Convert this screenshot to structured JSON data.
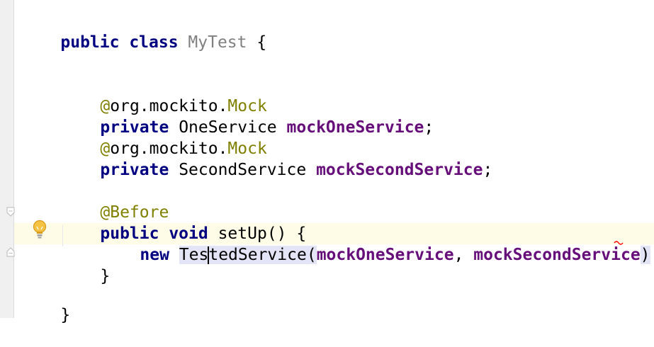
{
  "code": {
    "line1": {
      "kw": "public class",
      "name": "MyTest",
      "brace": "{"
    },
    "line2": {
      "at": "@",
      "pkg": "org.mockito.",
      "ann": "Mock"
    },
    "line3": {
      "kw": "private",
      "type": "OneService",
      "field": "mockOneService",
      "semi": ";"
    },
    "line4": {
      "at": "@",
      "pkg": "org.mockito.",
      "ann": "Mock"
    },
    "line5": {
      "kw": "private",
      "type": "SecondService",
      "field": "mockSecondService",
      "semi": ";"
    },
    "line6": {
      "ann": "@Before"
    },
    "line7": {
      "kw": "public void",
      "method": "setUp() {"
    },
    "line8": {
      "kw": "new",
      "type_before_caret": "Tes",
      "type_after_caret": "tedService",
      "open": "(",
      "arg1": "mockOneService",
      "comma": ", ",
      "arg2": "mockSecondService",
      "close": ")"
    },
    "line9": {
      "brace": "}"
    },
    "line10": {
      "brace": "}"
    }
  },
  "icons": {
    "intention": "lightbulb-icon",
    "fold_start": "fold-start-icon",
    "fold_end": "fold-end-icon",
    "error_marker": "error-squiggle-icon"
  },
  "colors": {
    "keyword": "#000080",
    "annotation": "#808000",
    "field": "#660e7a",
    "class_name": "#808080",
    "caret_row": "#fefbe6",
    "identifier_highlight": "#e3e5f7",
    "error": "#ff0000"
  }
}
